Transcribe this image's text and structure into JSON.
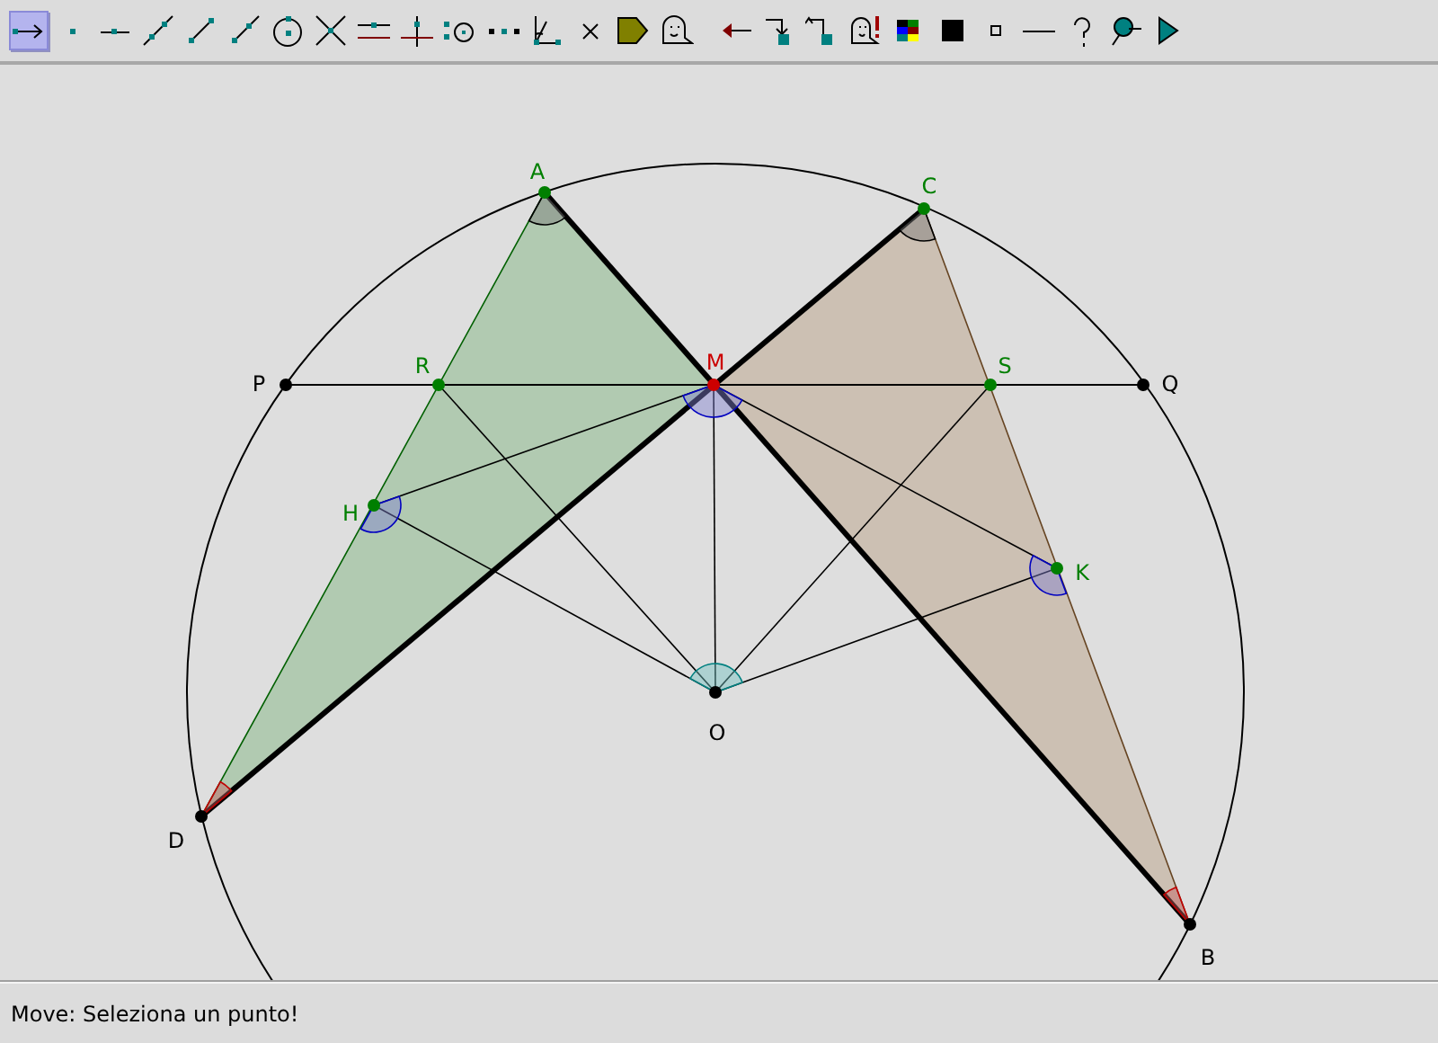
{
  "toolbar": {
    "tools": [
      {
        "kind": "move",
        "selected": true
      },
      {
        "kind": "point",
        "selected": false
      },
      {
        "kind": "segment-dot",
        "selected": false
      },
      {
        "kind": "line",
        "selected": false
      },
      {
        "kind": "segment",
        "selected": false
      },
      {
        "kind": "ray",
        "selected": false
      },
      {
        "kind": "circle",
        "selected": false
      },
      {
        "kind": "intersect",
        "selected": false
      },
      {
        "kind": "parallel",
        "selected": false
      },
      {
        "kind": "perpendicular",
        "selected": false
      },
      {
        "kind": "dot-circle",
        "selected": false
      },
      {
        "kind": "dots",
        "selected": false
      },
      {
        "kind": "angle",
        "selected": false
      },
      {
        "kind": "cross",
        "selected": false
      },
      {
        "kind": "pentagon",
        "selected": false
      },
      {
        "kind": "ghost",
        "selected": false
      },
      {
        "kind": "back-arrow",
        "selected": false
      },
      {
        "kind": "bin-down",
        "selected": false
      },
      {
        "kind": "bin-up",
        "selected": false
      },
      {
        "kind": "ghost-alert",
        "selected": false
      },
      {
        "kind": "palette",
        "selected": false
      },
      {
        "kind": "black-square",
        "selected": false
      },
      {
        "kind": "small-square",
        "selected": false
      },
      {
        "kind": "dash",
        "selected": false
      },
      {
        "kind": "question",
        "selected": false
      },
      {
        "kind": "pin",
        "selected": false
      },
      {
        "kind": "play",
        "selected": false
      }
    ]
  },
  "points": [
    {
      "label": "A",
      "color": "#007f00"
    },
    {
      "label": "C",
      "color": "#007f00"
    },
    {
      "label": "P",
      "color": "#000000"
    },
    {
      "label": "R",
      "color": "#007f00"
    },
    {
      "label": "M",
      "color": "#cc0000"
    },
    {
      "label": "S",
      "color": "#007f00"
    },
    {
      "label": "Q",
      "color": "#000000"
    },
    {
      "label": "H",
      "color": "#007f00"
    },
    {
      "label": "K",
      "color": "#007f00"
    },
    {
      "label": "O",
      "color": "#000000"
    },
    {
      "label": "D",
      "color": "#000000"
    },
    {
      "label": "B",
      "color": "#000000"
    }
  ],
  "status_bar": {
    "text": "Move: Seleziona un punto!"
  }
}
